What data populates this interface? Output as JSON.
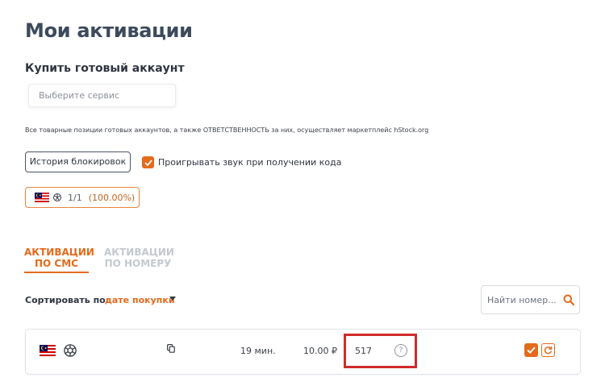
{
  "page": {
    "title": "Мои активации"
  },
  "buy_section": {
    "title": "Купить готовый аккаунт",
    "service_placeholder": "Выберите сервис",
    "notice": "Все товарные позиции готовых аккаунтов, а также ОТВЕТСТВЕННОСТЬ за них, осуществляет маркетплейс hStock.org"
  },
  "controls": {
    "history_button": "История блокировок",
    "sound_label": "Проигрывать звук при получении кода",
    "sound_checked": true
  },
  "stat_chip": {
    "count": "1/1",
    "percent": "(100.00%)",
    "flag_icon": "malaysia-flag-icon",
    "service_icon": "openai-icon"
  },
  "tabs": [
    {
      "line1": "АКТИВАЦИИ",
      "line2": "ПО СМС",
      "active": true
    },
    {
      "line1": "АКТИВАЦИИ",
      "line2": "ПО НОМЕРУ",
      "active": false
    }
  ],
  "sort": {
    "label": "Сортировать по:",
    "value": "дате покупки"
  },
  "search": {
    "placeholder": "Найти номер..."
  },
  "activation_row": {
    "flag_icon": "malaysia-flag-icon",
    "service_icon": "openai-icon",
    "time": "19 мин.",
    "price": "10.00 ₽",
    "code": "517",
    "help": "?"
  },
  "colors": {
    "accent": "#e46a1c",
    "highlight": "#d22a2a",
    "title": "#3c4a5c",
    "inactive_tab": "#c4c9d0"
  }
}
